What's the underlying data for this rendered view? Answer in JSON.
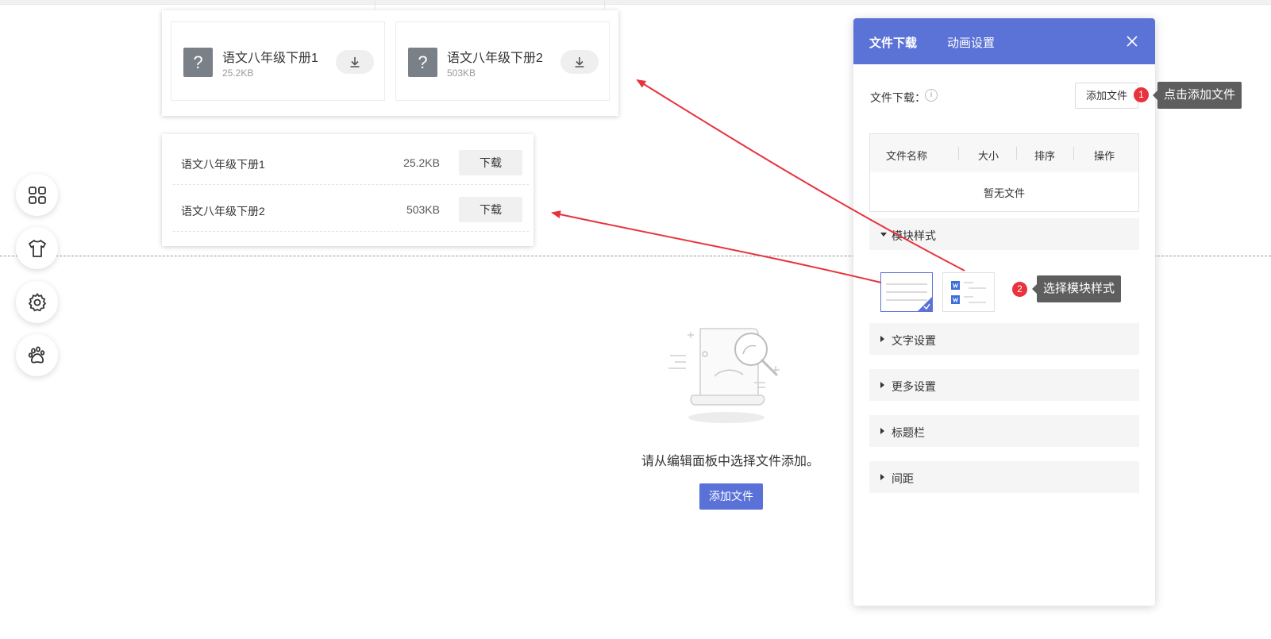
{
  "card_preview": {
    "files": [
      {
        "icon": "?",
        "name": "语文八年级下册1",
        "size": "25.2KB"
      },
      {
        "icon": "?",
        "name": "语文八年级下册2",
        "size": "503KB"
      }
    ]
  },
  "list_preview": {
    "rows": [
      {
        "name": "语文八年级下册1",
        "size": "25.2KB",
        "action": "下载"
      },
      {
        "name": "语文八年级下册2",
        "size": "503KB",
        "action": "下载"
      }
    ]
  },
  "empty_state": {
    "message": "请从编辑面板中选择文件添加。",
    "add_button": "添加文件"
  },
  "panel": {
    "tabs": [
      "文件下载",
      "动画设置"
    ],
    "file_download_label": "文件下载：",
    "info_glyph": "i",
    "add_file_button": "添加文件",
    "table": {
      "headers": [
        "文件名称",
        "大小",
        "排序",
        "操作"
      ],
      "empty_text": "暂无文件"
    },
    "sections": [
      "模块样式",
      "文字设置",
      "更多设置",
      "标题栏",
      "间距"
    ]
  },
  "callouts": [
    {
      "number": "1",
      "text": "点击添加文件"
    },
    {
      "number": "2",
      "text": "选择模块样式"
    }
  ],
  "colors": {
    "accent": "#5b73d6",
    "badge": "#e8323c",
    "arrow": "#e8323c",
    "tooltip_bg": "#5e5e5e"
  },
  "icons": {
    "tools": [
      "grid-icon",
      "shirt-icon",
      "gear-icon",
      "paw-icon"
    ],
    "panel_close": "close-icon",
    "download": "download-icon"
  }
}
